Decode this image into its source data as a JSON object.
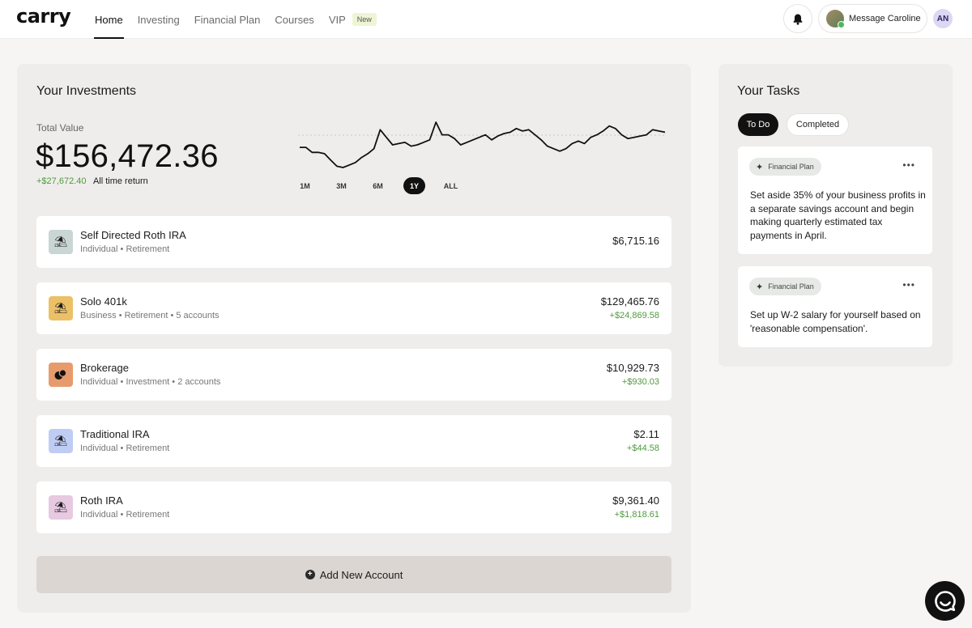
{
  "header": {
    "logo": "carry",
    "nav": [
      {
        "label": "Home",
        "active": true
      },
      {
        "label": "Investing"
      },
      {
        "label": "Financial Plan"
      },
      {
        "label": "Courses"
      },
      {
        "label": "VIP"
      }
    ],
    "vip_badge": "New",
    "message_label": "Message Caroline",
    "user_initials": "AN"
  },
  "investments": {
    "title": "Your Investments",
    "total_label": "Total Value",
    "total_value": "$156,472.36",
    "return_amount": "+$27,672.40",
    "return_label": "All time return",
    "ranges": [
      "1M",
      "3M",
      "6M",
      "1Y",
      "ALL"
    ],
    "selected_range": "1Y",
    "accounts": [
      {
        "name": "Self Directed Roth IRA",
        "sub": "Individual • Retirement",
        "value": "$6,715.16",
        "gain": "",
        "icon": "umbrella-icon"
      },
      {
        "name": "Solo 401k",
        "sub": "Business • Retirement • 5 accounts",
        "value": "$129,465.76",
        "gain": "+$24,869.58",
        "icon": "umbrella-icon"
      },
      {
        "name": "Brokerage",
        "sub": "Individual • Investment • 2 accounts",
        "value": "$10,929.73",
        "gain": "+$930.03",
        "icon": "coins-icon"
      },
      {
        "name": "Traditional IRA",
        "sub": "Individual • Retirement",
        "value": "$2.11",
        "gain": "+$44.58",
        "icon": "umbrella-icon"
      },
      {
        "name": "Roth IRA",
        "sub": "Individual • Retirement",
        "value": "$9,361.40",
        "gain": "+$1,818.61",
        "icon": "umbrella-icon"
      }
    ],
    "add_label": "Add New Account"
  },
  "colors": {
    "accent_green": "#4f9a3c",
    "icon_bg": [
      "#c9d6d3",
      "#ecc067",
      "#e79b6c",
      "#bfcdf4",
      "#e7c9e1"
    ]
  },
  "tasks": {
    "title": "Your Tasks",
    "tab_todo": "To Do",
    "tab_completed": "Completed",
    "items": [
      {
        "tag": "Financial Plan",
        "text": "Set aside 35% of your business profits in a separate savings account and begin making quarterly estimated tax payments in April."
      },
      {
        "tag": "Financial Plan",
        "text": "Set up W-2 salary for yourself based on 'reasonable compensation'."
      }
    ]
  },
  "chart_data": {
    "type": "line",
    "values": [
      60,
      60,
      56,
      56,
      55,
      50,
      45,
      44,
      46,
      48,
      52,
      55,
      59,
      74,
      68,
      62,
      63,
      64,
      61,
      62,
      64,
      66,
      80,
      70,
      70,
      67,
      62,
      64,
      66,
      68,
      70,
      66,
      69,
      71,
      72,
      75,
      73,
      74,
      70,
      66,
      61,
      59,
      57,
      59,
      63,
      65,
      63,
      68,
      70,
      73,
      77,
      75,
      70,
      67,
      68,
      69,
      70,
      74,
      73,
      72
    ]
  }
}
